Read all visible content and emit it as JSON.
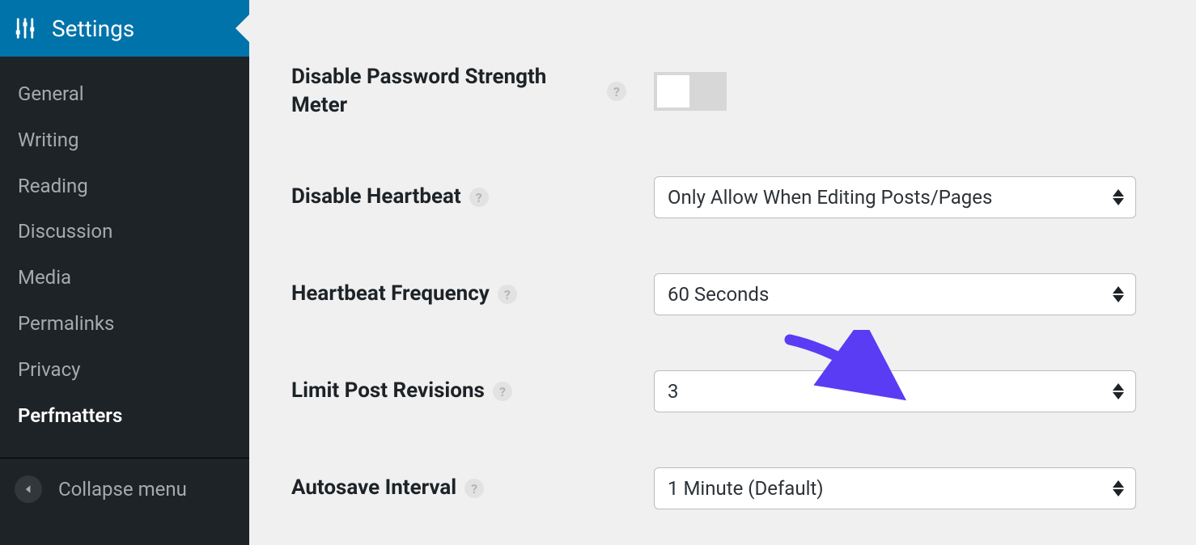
{
  "sidebar": {
    "header": {
      "label": "Settings"
    },
    "items": [
      {
        "label": "General",
        "active": false
      },
      {
        "label": "Writing",
        "active": false
      },
      {
        "label": "Reading",
        "active": false
      },
      {
        "label": "Discussion",
        "active": false
      },
      {
        "label": "Media",
        "active": false
      },
      {
        "label": "Permalinks",
        "active": false
      },
      {
        "label": "Privacy",
        "active": false
      },
      {
        "label": "Perfmatters",
        "active": true
      }
    ],
    "collapse_label": "Collapse menu"
  },
  "settings": {
    "password_meter": {
      "label": "Disable Password Strength Meter",
      "value": false
    },
    "disable_heartbeat": {
      "label": "Disable Heartbeat",
      "value": "Only Allow When Editing Posts/Pages"
    },
    "heartbeat_frequency": {
      "label": "Heartbeat Frequency",
      "value": "60 Seconds"
    },
    "limit_post_revisions": {
      "label": "Limit Post Revisions",
      "value": "3"
    },
    "autosave_interval": {
      "label": "Autosave Interval",
      "value": "1 Minute (Default)"
    }
  },
  "help_glyph": "?",
  "annotation": {
    "color": "#5a3cf4"
  }
}
